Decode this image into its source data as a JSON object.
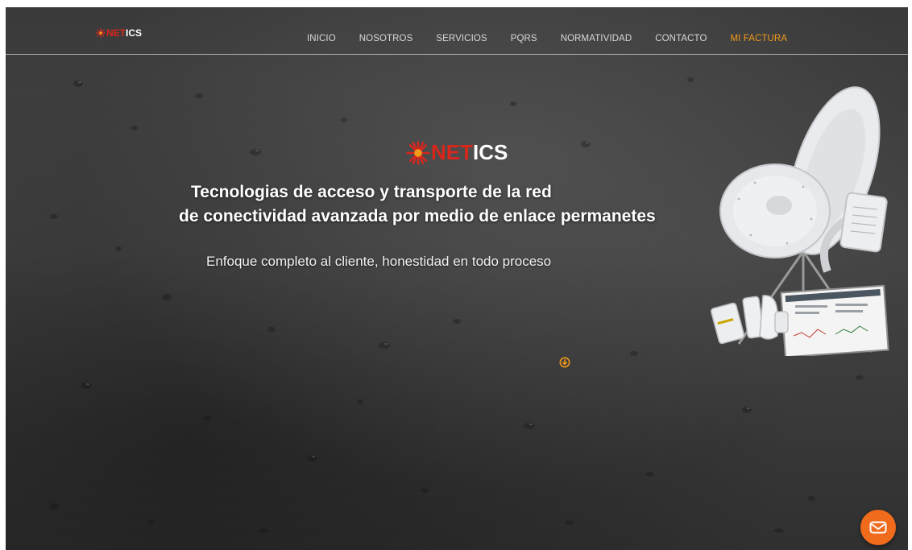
{
  "brand": {
    "logo_net": "NET",
    "logo_ics": "ICS",
    "accent_red": "#d9261c",
    "accent_orange": "#f39a1b"
  },
  "nav": {
    "items": [
      {
        "label": "INICIO"
      },
      {
        "label": "NOSOTROS"
      },
      {
        "label": "SERVICIOS"
      },
      {
        "label": "PQRS"
      },
      {
        "label": "NORMATIVIDAD"
      },
      {
        "label": "CONTACTO"
      },
      {
        "label": "MI FACTURA"
      }
    ],
    "active_index": 6
  },
  "hero": {
    "logo_net": "NET",
    "logo_ics": "ICS",
    "headline_line1": "Tecnologias de acceso y transporte de la red",
    "headline_line2": "de conectividad avanzada por medio de enlace permanetes",
    "subtitle": "Enfoque completo al cliente, honestidad en todo proceso"
  },
  "icons": {
    "scroll_down": "circle-down-arrow-icon",
    "chat": "envelope-icon",
    "equipment": "antenna-equipment-image"
  }
}
